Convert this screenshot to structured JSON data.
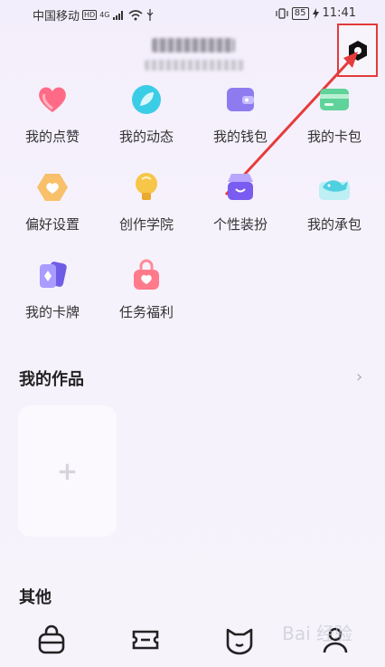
{
  "status_bar": {
    "carrier": "中国移动",
    "hd": "HD",
    "network": "4G",
    "battery": "85",
    "time": "11:41"
  },
  "header": {
    "settings_icon": "gear-hex-icon"
  },
  "features": [
    {
      "label": "我的点赞",
      "icon": "heart-icon",
      "color": "#ff5c7a"
    },
    {
      "label": "我的动态",
      "icon": "leaf-icon",
      "color": "#36c9e6"
    },
    {
      "label": "我的钱包",
      "icon": "wallet-icon",
      "color": "#8f7bf0"
    },
    {
      "label": "我的卡包",
      "icon": "card-pack-icon",
      "color": "#5fd39a"
    },
    {
      "label": "偏好设置",
      "icon": "preference-heart-icon",
      "color": "#f6b352"
    },
    {
      "label": "创作学院",
      "icon": "lightbulb-icon",
      "color": "#f5c04a"
    },
    {
      "label": "个性装扮",
      "icon": "shop-icon",
      "color": "#7a5cf0"
    },
    {
      "label": "我的承包",
      "icon": "whale-icon",
      "color": "#4fd0e0"
    },
    {
      "label": "我的卡牌",
      "icon": "cards-icon",
      "color": "#8c7cf5"
    },
    {
      "label": "任务福利",
      "icon": "gift-bag-icon",
      "color": "#ff7a8a"
    }
  ],
  "works": {
    "title": "我的作品",
    "chevron": "›",
    "add": "+"
  },
  "other": {
    "title": "其他"
  },
  "watermark": "Bai 经验"
}
